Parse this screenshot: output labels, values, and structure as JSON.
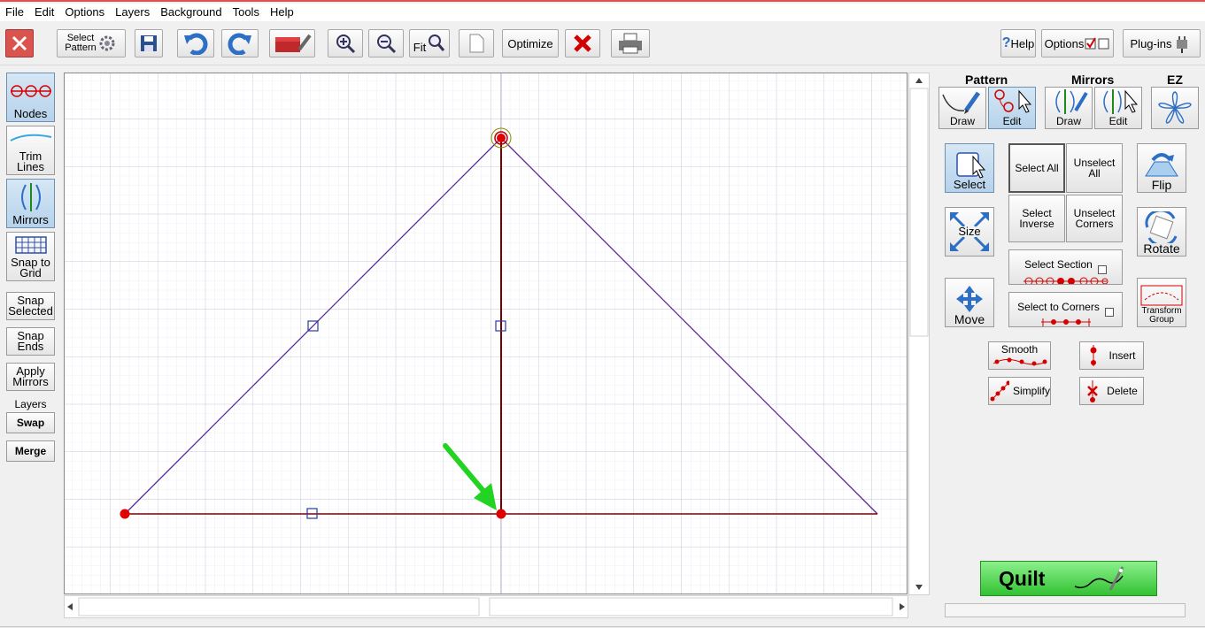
{
  "menu": [
    "File",
    "Edit",
    "Options",
    "Layers",
    "Background",
    "Tools",
    "Help"
  ],
  "toolbar": {
    "select_pattern_line1": "Select",
    "select_pattern_line2": "Pattern",
    "fit": "Fit",
    "optimize": "Optimize",
    "help": "Help",
    "options": "Options",
    "plugins": "Plug-ins"
  },
  "left": {
    "nodes": "Nodes",
    "trim1": "Trim",
    "trim2": "Lines",
    "mirrors": "Mirrors",
    "snap1": "Snap to",
    "snap2": "Grid",
    "snapsel1": "Snap",
    "snapsel2": "Selected",
    "snapends1": "Snap",
    "snapends2": "Ends",
    "apply1": "Apply",
    "apply2": "Mirrors",
    "layers": "Layers",
    "swap": "Swap",
    "merge": "Merge"
  },
  "right": {
    "pattern": "Pattern",
    "mirrors": "Mirrors",
    "ez": "EZ",
    "draw": "Draw",
    "edit": "Edit",
    "select": "Select",
    "select_all": "Select All",
    "unselect_all1": "Unselect",
    "unselect_all2": "All",
    "flip": "Flip",
    "size": "Size",
    "select_inverse1": "Select",
    "select_inverse2": "Inverse",
    "unselect_corners1": "Unselect",
    "unselect_corners2": "Corners",
    "rotate": "Rotate",
    "select_section": "Select Section",
    "move": "Move",
    "select_to_corners": "Select to Corners",
    "transform1": "Transform",
    "transform2": "Group",
    "smooth": "Smooth",
    "insert": "Insert",
    "simplify": "Simplify",
    "delete": "Delete",
    "quilt": "Quilt"
  },
  "colors": {
    "accent_red": "#d9534f",
    "node_red": "#e00000",
    "line_dark_red": "#7a0000",
    "quilt_green": "#33c233",
    "arrow_green": "#22d322",
    "grid": "#d8d8ea"
  }
}
